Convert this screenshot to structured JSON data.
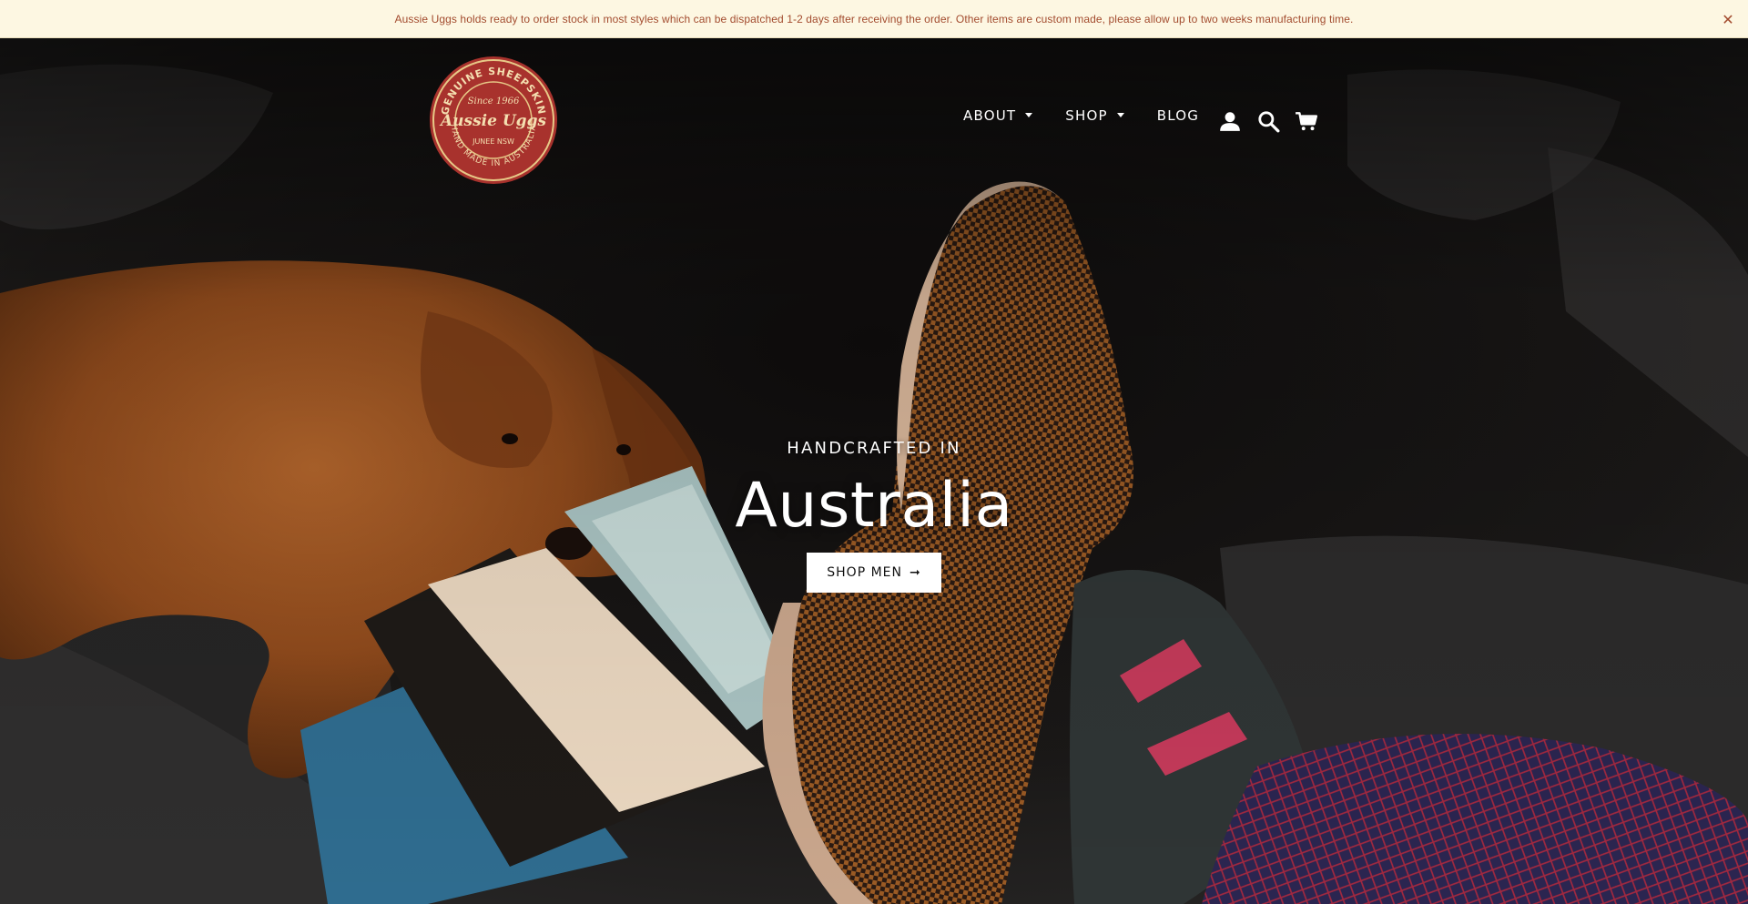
{
  "announcement": {
    "text": "Aussie Uggs holds ready to order stock in most styles which can be dispatched 1-2 days after receiving the order. Other items are custom made, please allow up to two weeks manufacturing time.",
    "close_glyph": "✕"
  },
  "logo": {
    "top_arc": "GENUINE SHEEPSKIN",
    "since": "Since 1966",
    "brand": "Aussie Uggs",
    "location": "JUNEE NSW",
    "bottom_arc": "HAND MADE IN AUSTRALIA",
    "colors": {
      "badge": "#a8322d",
      "ring": "#e7c987",
      "text": "#f4dfb0"
    }
  },
  "nav": {
    "items": [
      {
        "label": "ABOUT",
        "has_dropdown": true
      },
      {
        "label": "SHOP",
        "has_dropdown": true
      },
      {
        "label": "BLOG",
        "has_dropdown": false
      }
    ],
    "icons": [
      "account-icon",
      "search-icon",
      "cart-icon"
    ]
  },
  "hero": {
    "kicker": "HANDCRAFTED IN",
    "title": "Australia",
    "button_label": "SHOP MEN",
    "button_arrow": "➞"
  },
  "colors": {
    "announcement_bg": "#fdf7e2",
    "announcement_text": "#a34c2f",
    "nav_text": "#ffffff",
    "button_bg": "#ffffff",
    "button_text": "#111111"
  }
}
